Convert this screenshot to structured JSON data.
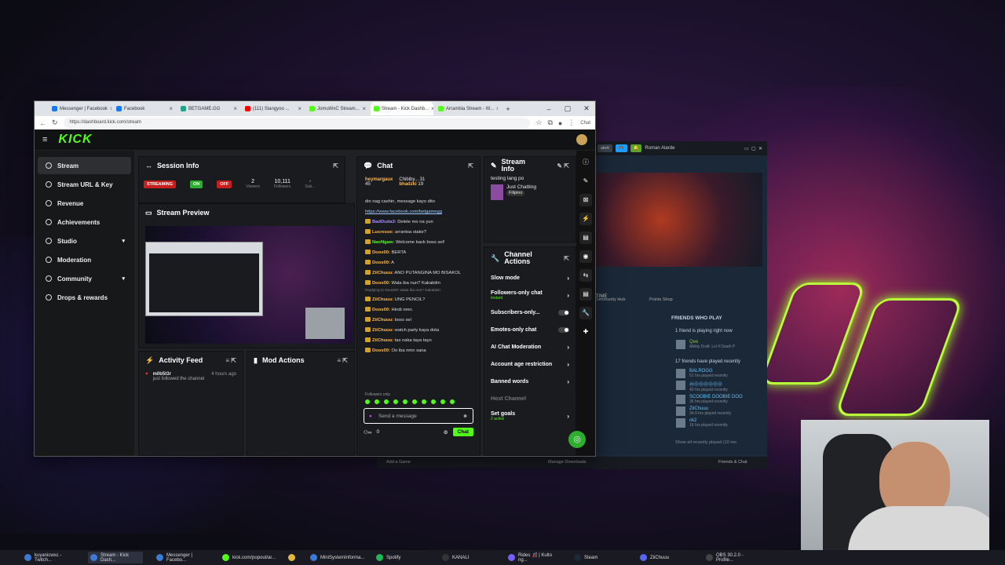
{
  "browser": {
    "tabs": [
      {
        "label": "Messenger | Facebook",
        "color": "#1877f2"
      },
      {
        "label": "Facebook",
        "color": "#1877f2"
      },
      {
        "label": "BETGAME.GG",
        "color": "#21a38a"
      },
      {
        "label": "(111) Slangyoo ...",
        "color": "#ff0000"
      },
      {
        "label": "JomuWxC Stream...",
        "color": "#53fc18"
      },
      {
        "label": "Stream - Kick Dashb...",
        "color": "#53fc18",
        "active": true
      },
      {
        "label": "Arrambia Stream - W...",
        "color": "#53fc18"
      }
    ],
    "url": "https://dashboard.kick.com/stream",
    "chat_btn": "Chat"
  },
  "kick": {
    "logo": "KICK"
  },
  "sidebar": [
    {
      "label": "Stream",
      "selected": true
    },
    {
      "label": "Stream URL & Key"
    },
    {
      "label": "Revenue"
    },
    {
      "label": "Achievements"
    },
    {
      "label": "Studio",
      "chevron": "▾"
    },
    {
      "label": "Moderation"
    },
    {
      "label": "Community",
      "chevron": "▾"
    },
    {
      "label": "Drops & rewards"
    }
  ],
  "session": {
    "title": "Session Info",
    "streaming": "STREAMING",
    "on": "ON",
    "off": "OFF",
    "viewers": "2",
    "viewers_label": "Viewers",
    "followers": "10,111",
    "followers_label": "Followers",
    "subs": "-",
    "subs_label": "Sub..."
  },
  "preview": {
    "title": "Stream Preview"
  },
  "activity": {
    "title": "Activity Feed",
    "user": "m0b5t3r",
    "time": "4 hours ago",
    "text": "just followed the channel"
  },
  "mod": {
    "title": "Mod Actions"
  },
  "chat": {
    "title": "Chat",
    "pinned": [
      {
        "name": "heymargaux",
        "count": "45"
      },
      {
        "name": "Chibiby...",
        "count": "31"
      },
      {
        "name": "bhadzki",
        "count": "19"
      }
    ],
    "lines": [
      {
        "user": "",
        "text": "din nag cashin, message kayo dito",
        "cls": ""
      },
      {
        "user": "",
        "text": "https://www.facebook.com/betgamegg",
        "cls": "link"
      },
      {
        "user": "BadDuda3:",
        "text": "Delete mo na yun",
        "cls": "u3"
      },
      {
        "user": "Lucresse:",
        "text": "arrantxa stake?",
        "cls": "u2"
      },
      {
        "user": "NaoNgaw:",
        "text": "Welcome back boss sel!",
        "cls": "u"
      },
      {
        "user": "Doos00:",
        "text": "BERTA",
        "cls": "u2"
      },
      {
        "user": "Doos00:",
        "text": "A",
        "cls": "u2"
      },
      {
        "user": "ZiiChuuu:",
        "text": "ANO PUTANGINA MO BISAKOL",
        "cls": "u2"
      },
      {
        "user": "Doos00:",
        "text": "Wala iba nun? Kakabitin",
        "cls": "u2"
      },
      {
        "user": "ZiiChuuu:",
        "text": "UNG PENCIL?",
        "cls": "u2"
      },
      {
        "user": "Doos00:",
        "text": "Hindi nmn.",
        "cls": "u2"
      },
      {
        "user": "ZiiChuuu:",
        "text": "boss sel",
        "cls": "u2"
      },
      {
        "user": "ZiiChuuu:",
        "text": "watch party kaya dota",
        "cls": "u2"
      },
      {
        "user": "ZiiChuuu:",
        "text": "tas naka taya tayo",
        "cls": "u2"
      },
      {
        "user": "Doos00:",
        "text": "Oo iba nmn sana",
        "cls": "u2"
      }
    ],
    "reply_note": "Replying to Doos00: Wala iba nun? Kakabitin",
    "followers_only": "Followers only",
    "placeholder": "Send a message",
    "count": "0",
    "send": "Chat"
  },
  "stream_info": {
    "title": "Stream Info",
    "stream_title": "testing lang po",
    "category": "Just Chatting",
    "tag": "Filipino"
  },
  "channel_actions": {
    "title": "Channel Actions",
    "items": [
      {
        "label": "Slow mode",
        "ctrl": "›"
      },
      {
        "label": "Followers-only chat",
        "sub": "Instant",
        "ctrl": "›"
      },
      {
        "label": "Subscribers-only...",
        "ctrl": "toggle"
      },
      {
        "label": "Emotes-only chat",
        "ctrl": "toggle"
      },
      {
        "label": "AI Chat Moderation",
        "ctrl": "›"
      },
      {
        "label": "Account age restriction",
        "ctrl": "›"
      },
      {
        "label": "Banned words",
        "ctrl": "›"
      },
      {
        "label": "Host Channel",
        "ctrl": "",
        "dim": true
      },
      {
        "label": "Set goals",
        "sub": "2 active",
        "ctrl": "›"
      }
    ]
  },
  "steam": {
    "alert": "alert",
    "user": "Roman Alarde",
    "time_label": "TIME",
    "hub": "Community Hub",
    "shop": "Points Shop",
    "friends_title": "FRIENDS WHO PLAY",
    "playing_now": "1 friend is playing right now",
    "now_friend": {
      "name": "Qee",
      "status": "Ability Draft: Lvl 4 Death P"
    },
    "recent_title": "17 friends have played recently",
    "recent": [
      {
        "name": "BALROGG",
        "hrs": "51 hrs played recently"
      },
      {
        "name": "ⓂⓄⓄⓄⓄⓄⓄ",
        "hrs": "40 hrs played recently"
      },
      {
        "name": "SCOOBIE DOOBIE DOO",
        "hrs": "36 hrs played recently"
      },
      {
        "name": "ZiiChuuu",
        "hrs": "34.9 hrs played recently"
      },
      {
        "name": "ck2",
        "hrs": "16 hrs played recently"
      }
    ],
    "show_all": "Show all recently played (10 mo",
    "add_game": "Add a Game",
    "downloads": "Manage Downloads",
    "friends_chat": "Friends & Chat"
  },
  "taskbar": [
    {
      "label": "kuyanicwxc - Twitch...",
      "color": "#3a7bd5"
    },
    {
      "label": "Stream - Kick Dash...",
      "color": "#3a7bd5",
      "selected": true
    },
    {
      "label": "Messenger | Facebo...",
      "color": "#3a7bd5"
    },
    {
      "label": "kick.com/popout/ar...",
      "color": "#53fc18"
    },
    {
      "label": "",
      "color": "#e8b73a"
    },
    {
      "label": "MiniSystemInforma...",
      "color": "#3a7bd5"
    },
    {
      "label": "Spotify",
      "color": "#1db954"
    },
    {
      "label": "KANALI",
      "color": "#333"
    },
    {
      "label": "Rides 🎢 | Kulto ng...",
      "color": "#7a5cff"
    },
    {
      "label": "Steam",
      "color": "#1b2838"
    },
    {
      "label": "ZiiChuuu",
      "color": "#5865f2"
    },
    {
      "label": "OBS 30.2.0 - Profile...",
      "color": "#444"
    }
  ]
}
